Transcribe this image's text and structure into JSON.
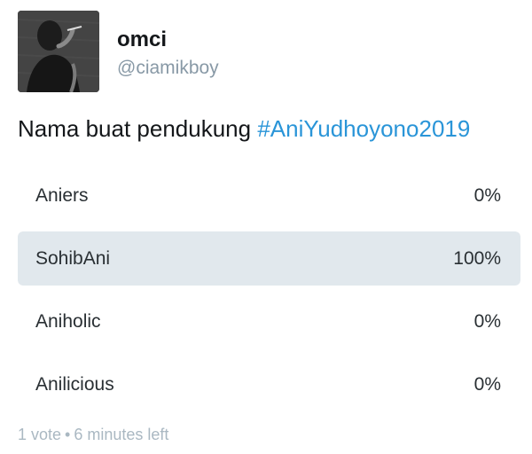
{
  "user": {
    "display_name": "omci",
    "handle": "@ciamikboy"
  },
  "tweet": {
    "text": "Nama buat pendukung ",
    "hashtag": "#AniYudhoyono2019"
  },
  "poll": {
    "options": [
      {
        "label": "Aniers",
        "percent_text": "0%",
        "percent": 0
      },
      {
        "label": "SohibAni",
        "percent_text": "100%",
        "percent": 100
      },
      {
        "label": "Aniholic",
        "percent_text": "0%",
        "percent": 0
      },
      {
        "label": "Anilicious",
        "percent_text": "0%",
        "percent": 0
      }
    ],
    "votes": "1 vote",
    "separator": "•",
    "time_left": "6 minutes left"
  },
  "colors": {
    "hashtag": "#2a95d8",
    "bar_fill": "#e1e8ed",
    "meta_text": "#aab8c2"
  },
  "icons": {
    "avatar": "profile-photo"
  }
}
